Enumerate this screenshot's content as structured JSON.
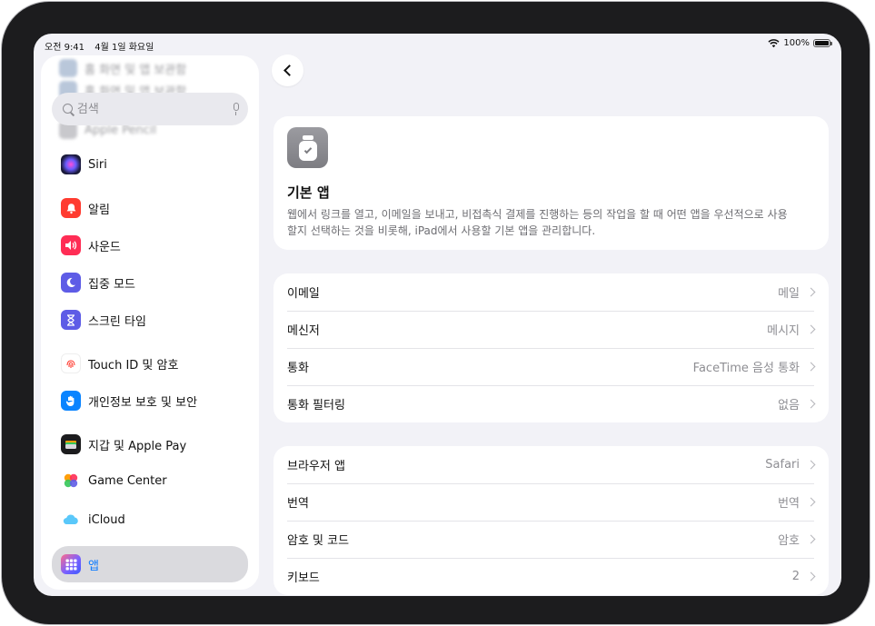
{
  "status_bar": {
    "time": "오전 9:41",
    "date": "4월 1일 화요일",
    "battery": "100%",
    "battery_level": 1.0
  },
  "sidebar": {
    "faded_items": [
      "홈 화면 및 앱 보관함",
      "Apple Pencil"
    ],
    "search_placeholder": "검색",
    "items": [
      {
        "label": "Siri",
        "icon": "siri-icon",
        "color": "#2b2b5e"
      },
      {
        "label": "알림",
        "icon": "bell-icon",
        "color": "#ff3b30"
      },
      {
        "label": "사운드",
        "icon": "speaker-icon",
        "color": "#ff2d55"
      },
      {
        "label": "집중 모드",
        "icon": "moon-icon",
        "color": "#5e5ce6"
      },
      {
        "label": "스크린 타임",
        "icon": "hourglass-icon",
        "color": "#5e5ce6"
      },
      {
        "label": "Touch ID 및 암호",
        "icon": "fingerprint-icon",
        "color": "#ff3b30"
      },
      {
        "label": "개인정보 보호 및 보안",
        "icon": "hand-icon",
        "color": "#0a84ff"
      },
      {
        "label": "지갑 및 Apple Pay",
        "icon": "wallet-icon",
        "color": "#1c1c1e"
      },
      {
        "label": "Game Center",
        "icon": "game-center-icon",
        "color": "#ff9f0a"
      },
      {
        "label": "iCloud",
        "icon": "cloud-icon",
        "color": "#5ac8fa"
      },
      {
        "label": "앱",
        "icon": "apps-grid-icon",
        "color": "#5e5ce6",
        "selected": true
      }
    ]
  },
  "header": {
    "title": "기본 앱",
    "description": "웹에서 링크를 열고, 이메일을 보내고, 비접촉식 결제를 진행하는 등의 작업을 할 때 어떤 앱을 우선적으로 사용할지 선택하는 것을 비롯해, iPad에서 사용할 기본 앱을 관리합니다."
  },
  "groups": [
    {
      "rows": [
        {
          "label": "이메일",
          "value": "메일"
        },
        {
          "label": "메신저",
          "value": "메시지"
        },
        {
          "label": "통화",
          "value": "FaceTime 음성 통화"
        },
        {
          "label": "통화 필터링",
          "value": "없음"
        }
      ]
    },
    {
      "rows": [
        {
          "label": "브라우저 앱",
          "value": "Safari"
        },
        {
          "label": "번역",
          "value": "번역"
        },
        {
          "label": "암호 및 코드",
          "value": "암호"
        },
        {
          "label": "키보드",
          "value": "2"
        }
      ]
    }
  ]
}
